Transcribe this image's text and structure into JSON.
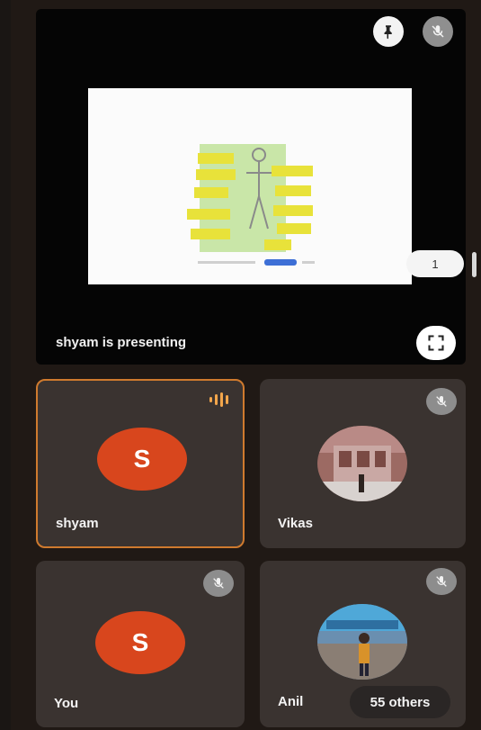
{
  "presentation": {
    "label": "shyam is presenting",
    "pill_text": "1"
  },
  "participants": [
    {
      "name": "shyam",
      "initial": "S",
      "speaking": true,
      "avatar_color": "#d8461d"
    },
    {
      "name": "Vikas",
      "muted": true
    },
    {
      "name": "You",
      "initial": "S",
      "muted": true,
      "avatar_color": "#d8461d"
    },
    {
      "name": "Anil",
      "muted": true
    }
  ],
  "overflow": {
    "label": "55 others"
  },
  "colors": {
    "accent_border": "#cf7a2e",
    "speaking": "#f3a64b",
    "tile_bg": "#3a3330"
  }
}
